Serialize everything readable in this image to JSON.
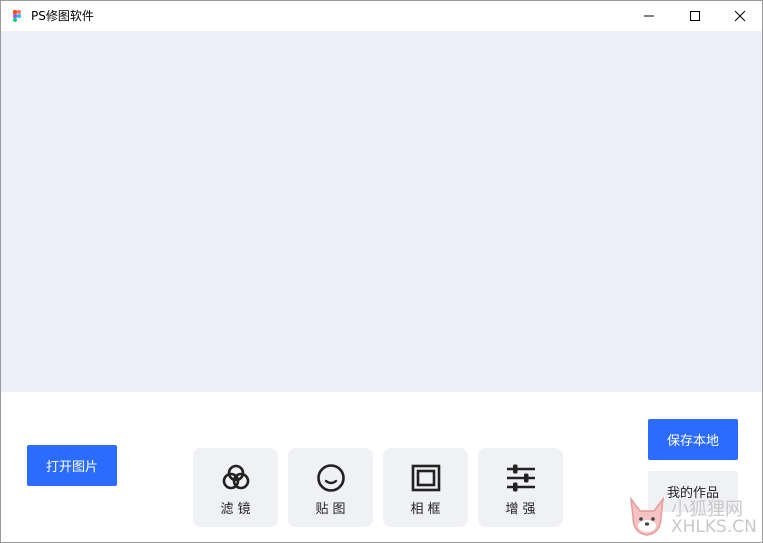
{
  "window": {
    "title": "PS修图软件",
    "colors": {
      "accent": "#2b6cff",
      "canvas_bg": "#edf0f8",
      "tool_bg": "#f0f1f5"
    }
  },
  "actions": {
    "open_label": "打开图片",
    "save_label": "保存本地",
    "works_label": "我的作品"
  },
  "tools": [
    {
      "label": "滤镜",
      "icon": "filter-circles-icon"
    },
    {
      "label": "贴图",
      "icon": "sticker-smiley-icon"
    },
    {
      "label": "相框",
      "icon": "photo-frame-icon"
    },
    {
      "label": "增强",
      "icon": "sliders-icon"
    }
  ],
  "watermark": {
    "text": "小狐狸网",
    "sub": "XHLKS.CN"
  }
}
